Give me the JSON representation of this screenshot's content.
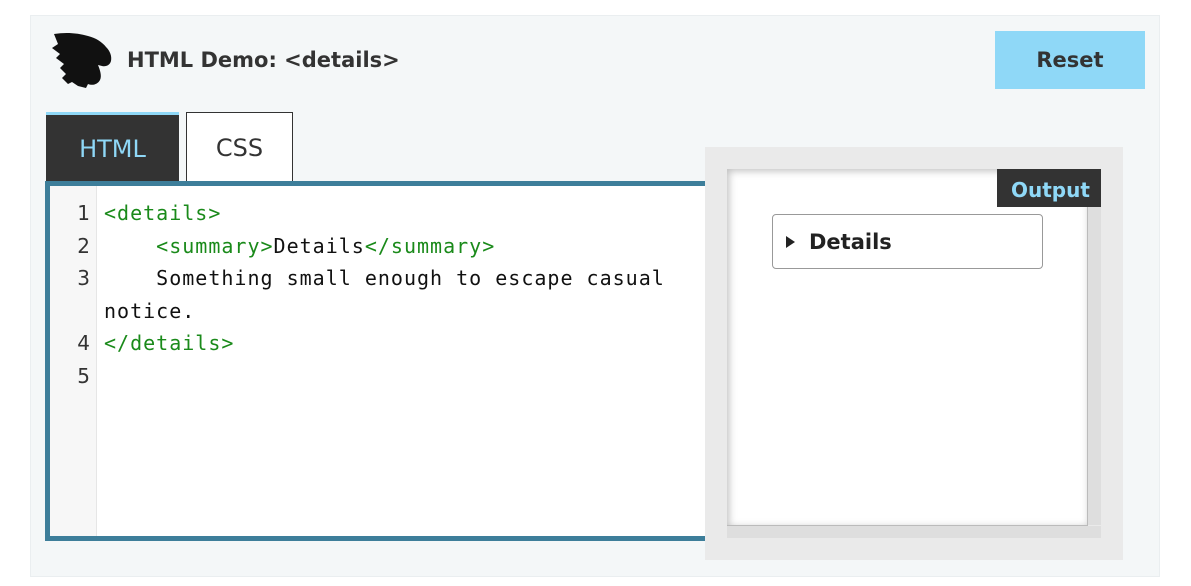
{
  "header": {
    "title": "HTML Demo: <details>",
    "reset_label": "Reset",
    "logo_icon": "dinosaur-head-logo"
  },
  "tabs": [
    {
      "label": "HTML",
      "active": true
    },
    {
      "label": "CSS",
      "active": false
    }
  ],
  "editor": {
    "line_numbers": [
      "1",
      "2",
      "3",
      "4",
      "5"
    ],
    "lines": [
      [
        {
          "t": "tag",
          "v": "<details>"
        }
      ],
      [
        {
          "t": "text",
          "v": "    "
        },
        {
          "t": "tag",
          "v": "<summary>"
        },
        {
          "t": "text",
          "v": "Details"
        },
        {
          "t": "tag",
          "v": "</summary>"
        }
      ],
      [
        {
          "t": "text",
          "v": "    Something small enough to escape casual notice."
        }
      ],
      [
        {
          "t": "tag",
          "v": "</details>"
        }
      ],
      []
    ]
  },
  "output": {
    "label": "Output",
    "details_summary": "Details",
    "details_open": false
  },
  "colors": {
    "accent": "#3d7e9a",
    "tab_active_text": "#8fd8f7",
    "reset_bg": "#8fd8f7",
    "tag_green": "#1a8a1a"
  }
}
